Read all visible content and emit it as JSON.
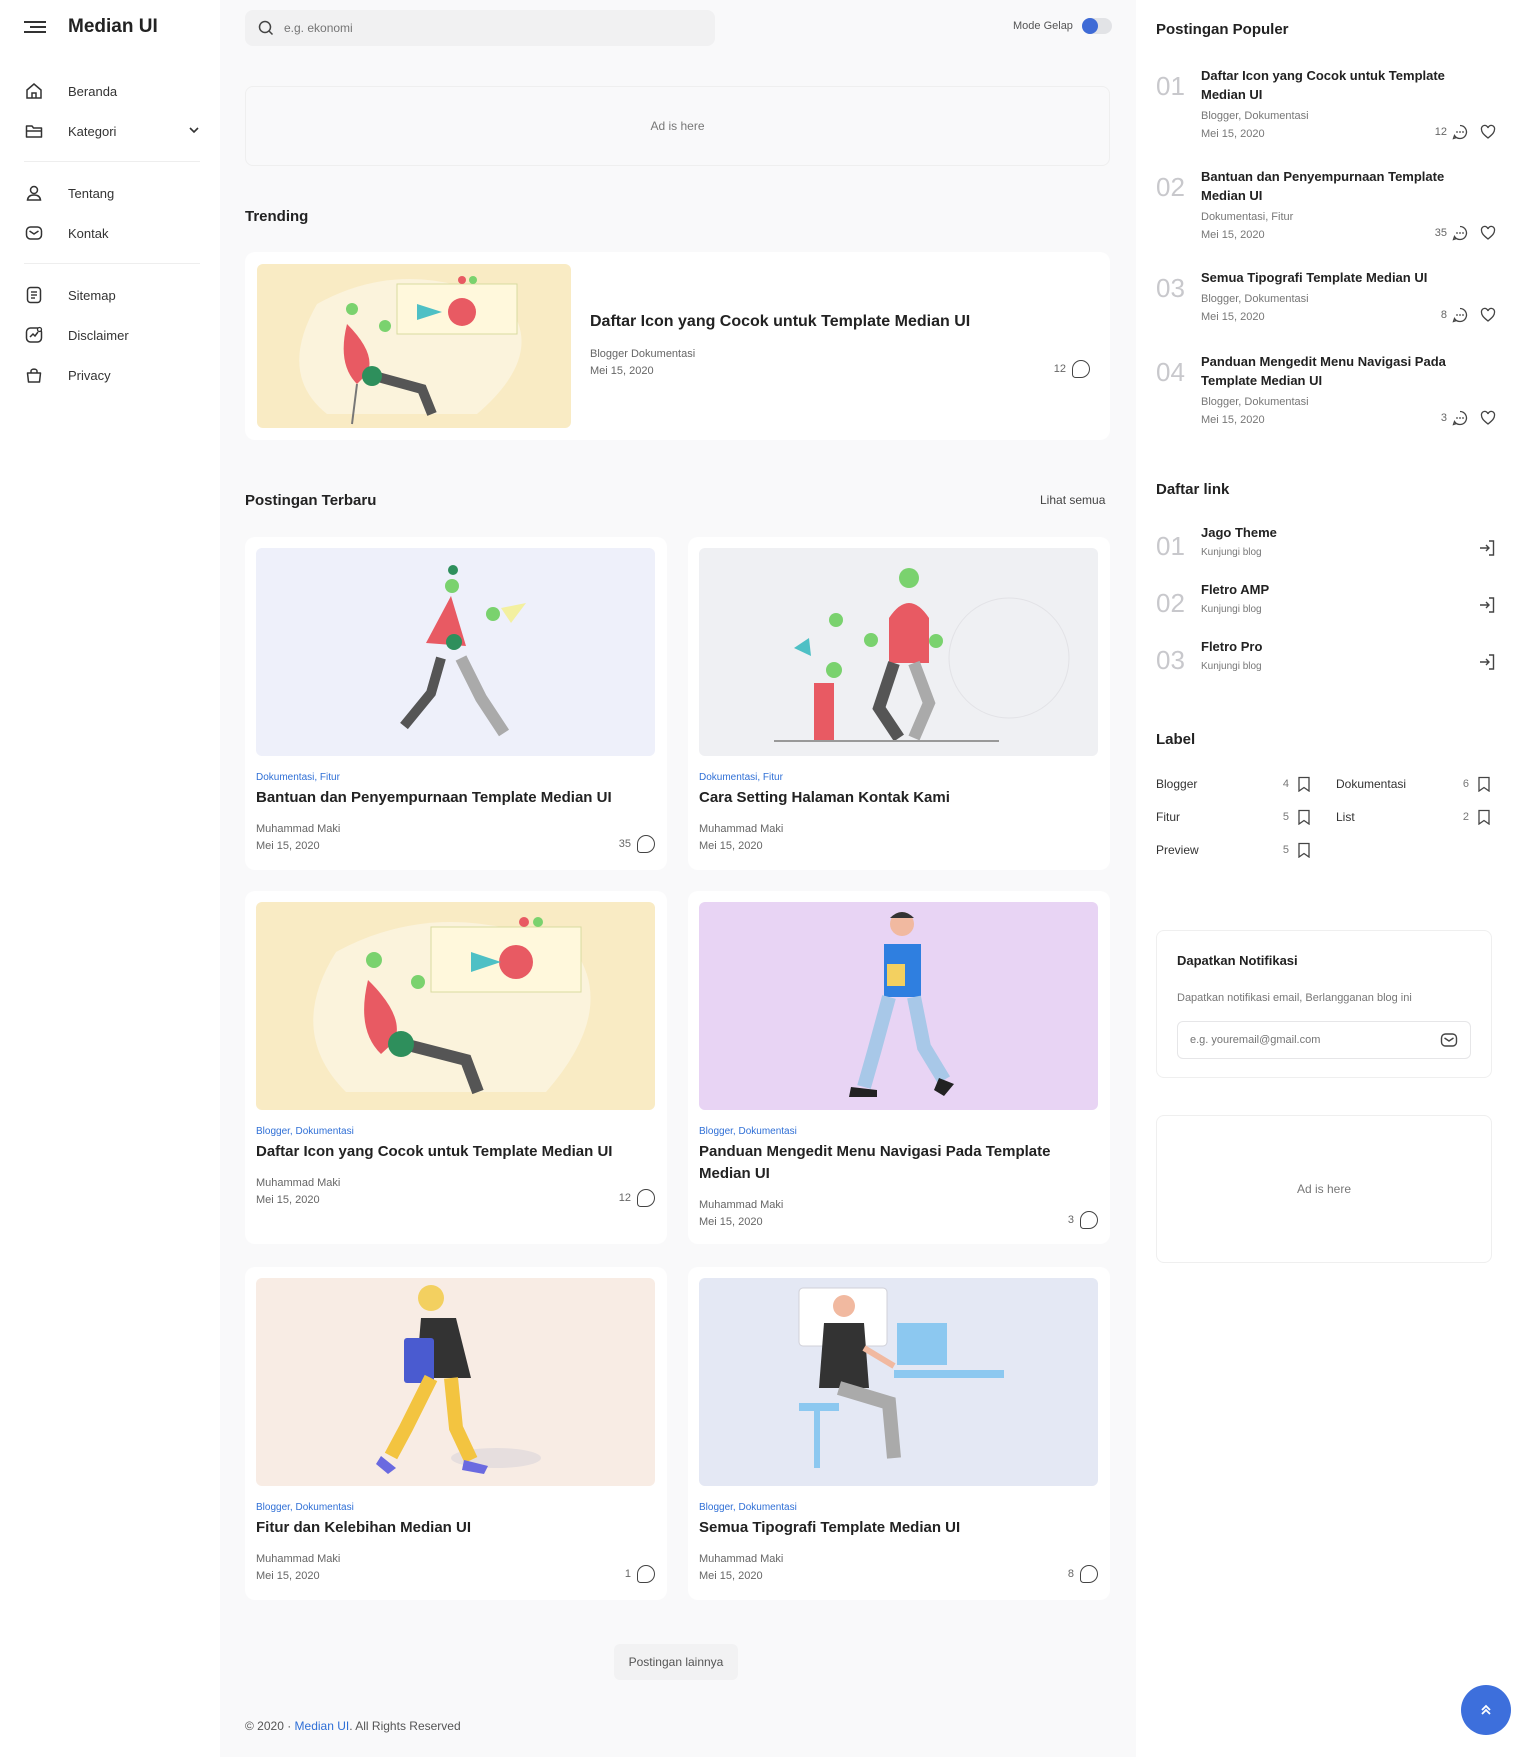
{
  "brand": {
    "name": "Median UI"
  },
  "sidebar": {
    "items": [
      {
        "label": "Beranda",
        "icon": "home-icon"
      },
      {
        "label": "Kategori",
        "icon": "folder-icon"
      },
      {
        "label": "Tentang",
        "icon": "user-icon"
      },
      {
        "label": "Kontak",
        "icon": "mail-icon"
      },
      {
        "label": "Sitemap",
        "icon": "document-icon"
      },
      {
        "label": "Disclaimer",
        "icon": "chart-icon"
      },
      {
        "label": "Privacy",
        "icon": "bag-icon"
      }
    ]
  },
  "header": {
    "search_placeholder": "e.g. ekonomi",
    "dark_mode_label": "Mode Gelap"
  },
  "ad_text": "Ad is here",
  "trending": {
    "title": "Trending",
    "post": {
      "title": "Daftar Icon yang Cocok untuk Template Median UI",
      "categories": "Blogger Dokumentasi",
      "date": "Mei 15, 2020",
      "comments": "12"
    }
  },
  "latest": {
    "title": "Postingan Terbaru",
    "see_all": "Lihat semua",
    "posts": [
      {
        "categories": "Dokumentasi, Fitur",
        "title": "Bantuan dan Penyempurnaan Template Median UI",
        "author": "Muhammad Maki",
        "date": "Mei 15, 2020",
        "comments": "35"
      },
      {
        "categories": "Dokumentasi, Fitur",
        "title": "Cara Setting Halaman Kontak Kami",
        "author": "Muhammad Maki",
        "date": "Mei 15, 2020",
        "comments": ""
      },
      {
        "categories": "Blogger, Dokumentasi",
        "title": "Daftar Icon yang Cocok untuk Template Median UI",
        "author": "Muhammad Maki",
        "date": "Mei 15, 2020",
        "comments": "12"
      },
      {
        "categories": "Blogger, Dokumentasi",
        "title": "Panduan Mengedit Menu Navigasi Pada Template Median UI",
        "author": "Muhammad Maki",
        "date": "Mei 15, 2020",
        "comments": "3"
      },
      {
        "categories": "Blogger, Dokumentasi",
        "title": "Fitur dan Kelebihan Median UI",
        "author": "Muhammad Maki",
        "date": "Mei 15, 2020",
        "comments": "1"
      },
      {
        "categories": "Blogger, Dokumentasi",
        "title": "Semua Tipografi Template Median UI",
        "author": "Muhammad Maki",
        "date": "Mei 15, 2020",
        "comments": "8"
      }
    ],
    "more_button": "Postingan lainnya"
  },
  "footer": {
    "prefix": "© 2020 · ",
    "link": "Median UI",
    "suffix": ". All Rights Reserved"
  },
  "popular": {
    "title": "Postingan Populer",
    "items": [
      {
        "num": "01",
        "title": "Daftar Icon yang Cocok untuk Template Median UI",
        "categories": "Blogger, Dokumentasi",
        "date": "Mei 15, 2020",
        "comments": "12"
      },
      {
        "num": "02",
        "title": "Bantuan dan Penyempurnaan Template Median UI",
        "categories": "Dokumentasi, Fitur",
        "date": "Mei 15, 2020",
        "comments": "35"
      },
      {
        "num": "03",
        "title": "Semua Tipografi Template Median UI",
        "categories": "Blogger, Dokumentasi",
        "date": "Mei 15, 2020",
        "comments": "8"
      },
      {
        "num": "04",
        "title": "Panduan Mengedit Menu Navigasi Pada Template Median UI",
        "categories": "Blogger, Dokumentasi",
        "date": "Mei 15, 2020",
        "comments": "3"
      }
    ]
  },
  "links": {
    "title": "Daftar link",
    "items": [
      {
        "num": "01",
        "name": "Jago Theme",
        "sub": "Kunjungi blog"
      },
      {
        "num": "02",
        "name": "Fletro AMP",
        "sub": "Kunjungi blog"
      },
      {
        "num": "03",
        "name": "Fletro Pro",
        "sub": "Kunjungi blog"
      }
    ]
  },
  "labels": {
    "title": "Label",
    "items": [
      {
        "name": "Blogger",
        "count": "4"
      },
      {
        "name": "Dokumentasi",
        "count": "6"
      },
      {
        "name": "Fitur",
        "count": "5"
      },
      {
        "name": "List",
        "count": "2"
      },
      {
        "name": "Preview",
        "count": "5"
      }
    ]
  },
  "notif": {
    "title": "Dapatkan Notifikasi",
    "desc": "Dapatkan notifikasi email, Berlangganan blog ini",
    "placeholder": "e.g. youremail@gmail.com"
  },
  "colors": {
    "accent": "#3d6fdc",
    "category": "#2f6fd6"
  }
}
